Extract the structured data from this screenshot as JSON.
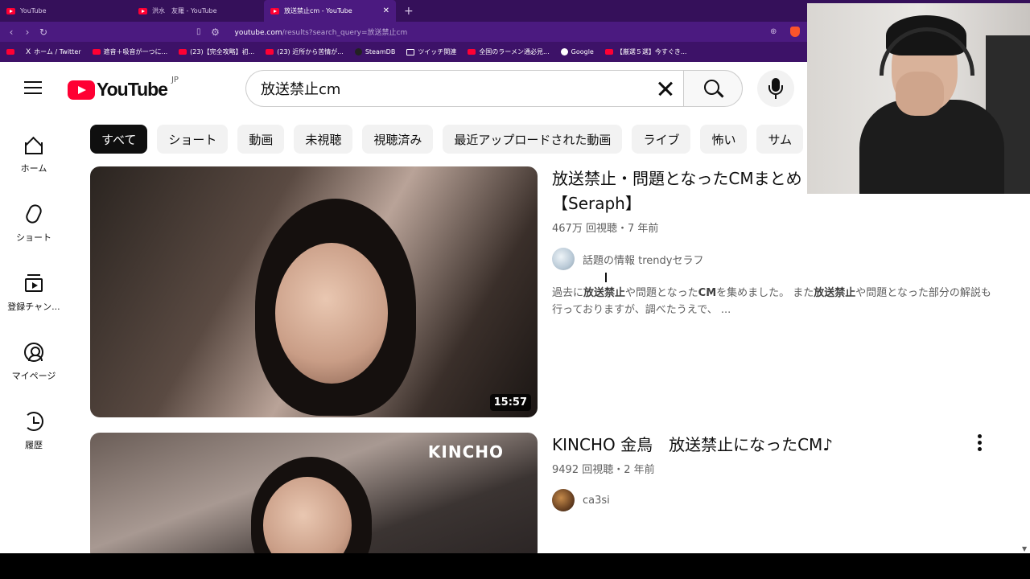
{
  "browser": {
    "tabs": [
      {
        "title": "YouTube",
        "active": false
      },
      {
        "title": "洪水　友羅 - YouTube",
        "active": false
      },
      {
        "title": "放送禁止cm - YouTube",
        "active": true
      }
    ],
    "new_tab_label": "+",
    "url_host": "youtube.com",
    "url_path": "/results?search_query=放送禁止cm",
    "bookmarks": [
      {
        "label": "",
        "icon": "youtube-icon"
      },
      {
        "label": "ホーム / Twitter",
        "icon": "x-icon"
      },
      {
        "label": "遮音＋吸音が一つに...",
        "icon": "youtube-icon"
      },
      {
        "label": "(23)【完全攻略】初...",
        "icon": "youtube-icon"
      },
      {
        "label": "(23) 近所から苦情が...",
        "icon": "youtube-icon"
      },
      {
        "label": "SteamDB",
        "icon": "steam-icon"
      },
      {
        "label": "ツイッチ関連",
        "icon": "folder-icon"
      },
      {
        "label": "全国のラーメン通必見...",
        "icon": "ramen-icon"
      },
      {
        "label": "Google",
        "icon": "google-icon"
      },
      {
        "label": "【厳選５選】今すぐき...",
        "icon": "youtube-icon"
      }
    ]
  },
  "youtube": {
    "logo_text": "YouTube",
    "region": "JP",
    "search_value": "放送禁止cm",
    "sidebar": [
      {
        "label": "ホーム",
        "icon": "home-icon"
      },
      {
        "label": "ショート",
        "icon": "shorts-icon"
      },
      {
        "label": "登録チャン...",
        "icon": "subscriptions-icon"
      },
      {
        "label": "マイページ",
        "icon": "you-icon"
      },
      {
        "label": "履歴",
        "icon": "history-icon"
      }
    ],
    "chips": [
      "すべて",
      "ショート",
      "動画",
      "未視聴",
      "視聴済み",
      "最近アップロードされた動画",
      "ライブ",
      "怖い",
      "サム"
    ],
    "results": [
      {
        "title_line1": "放送禁止・問題となったCMまとめ",
        "title_line2": "【Seraph】",
        "meta": "467万 回視聴・7 年前",
        "channel": "話題の情報 trendyセラフ",
        "duration": "15:57",
        "desc_parts": [
          "過去に",
          "放送禁止",
          "や問題となった",
          "CM",
          "を集めました。 また",
          "放送禁止",
          "や問題となった部分の解説も行っておりますが、調べたうえで、 ..."
        ]
      },
      {
        "title": "KINCHO 金鳥　放送禁止になったCM♪",
        "meta": "9492 回視聴・2 年前",
        "channel": "ca3si",
        "overlay_text": "KINCHO"
      }
    ]
  },
  "colors": {
    "chrome_tabbar": "#35105a",
    "chrome_urlbar": "#4b1a80",
    "youtube_red": "#ff0033"
  }
}
